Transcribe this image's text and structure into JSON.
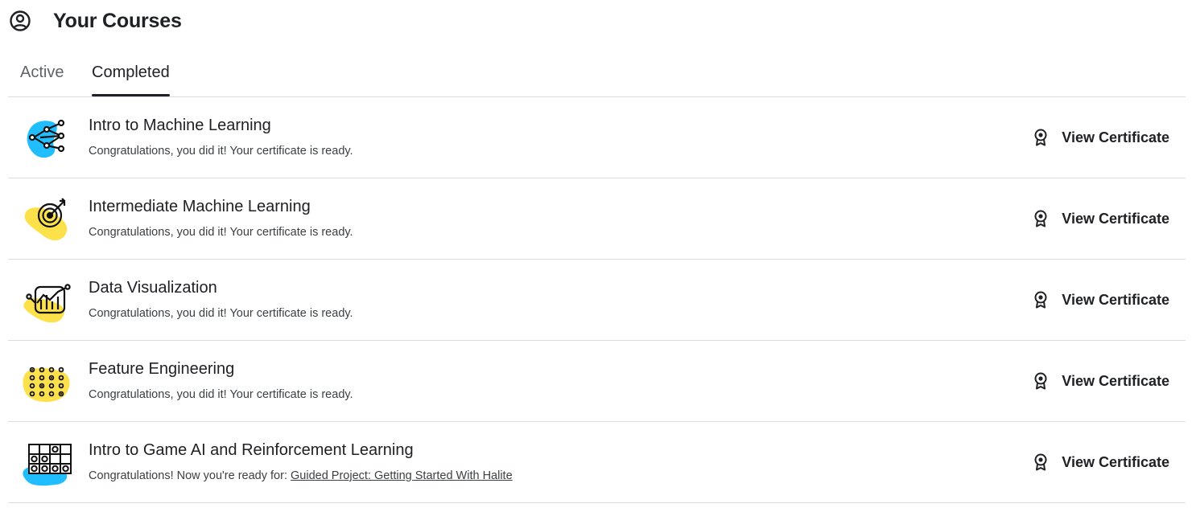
{
  "header": {
    "title": "Your Courses",
    "icon": "user-circle-icon"
  },
  "tabs": [
    {
      "label": "Active",
      "selected": false
    },
    {
      "label": "Completed",
      "selected": true
    }
  ],
  "colors": {
    "accent_blue": "#20beff",
    "accent_yellow": "#fde14b",
    "text_dark": "#202124",
    "divider": "#dadce0"
  },
  "courses": [
    {
      "title": "Intro to Machine Learning",
      "subtitle": "Congratulations, you did it! Your certificate is ready.",
      "icon": "network-nodes-icon",
      "icon_color": "#20beff",
      "action_label": "View Certificate"
    },
    {
      "title": "Intermediate Machine Learning",
      "subtitle": "Congratulations, you did it! Your certificate is ready.",
      "icon": "target-arrow-icon",
      "icon_color": "#fde14b",
      "action_label": "View Certificate"
    },
    {
      "title": "Data Visualization",
      "subtitle": "Congratulations, you did it! Your certificate is ready.",
      "icon": "bar-chart-icon",
      "icon_color": "#fde14b",
      "action_label": "View Certificate"
    },
    {
      "title": "Feature Engineering",
      "subtitle": "Congratulations, you did it! Your certificate is ready.",
      "icon": "dot-grid-icon",
      "icon_color": "#fde14b",
      "action_label": "View Certificate"
    },
    {
      "title": "Intro to Game AI and Reinforcement Learning",
      "subtitle_prefix": "Congratulations! Now you're ready for: ",
      "subtitle_link": "Guided Project: Getting Started With Halite",
      "icon": "game-board-icon",
      "icon_color": "#20beff",
      "action_label": "View Certificate"
    }
  ]
}
